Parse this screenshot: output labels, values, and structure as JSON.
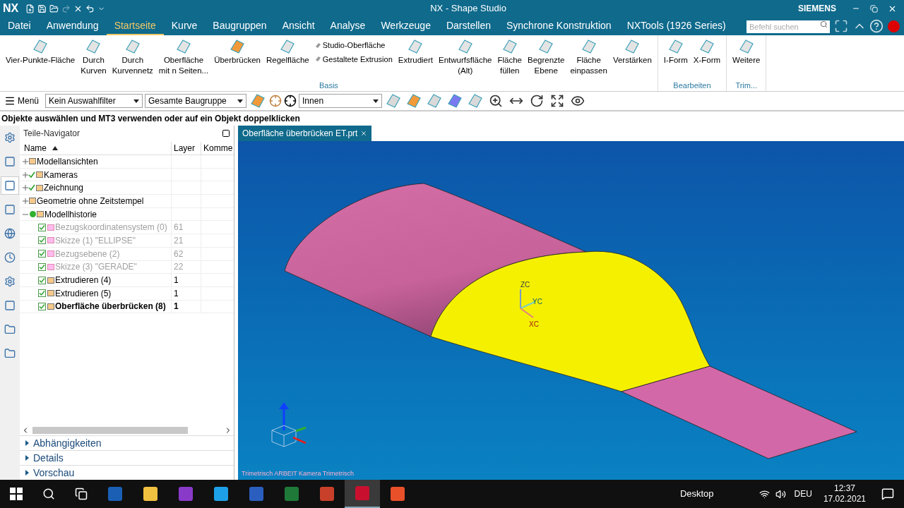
{
  "window": {
    "logo": "NX",
    "title": "NX - Shape Studio",
    "brand": "SIEMENS"
  },
  "menu_tabs": [
    {
      "label": "Datei",
      "selected": false
    },
    {
      "label": "Anwendung",
      "selected": false
    },
    {
      "label": "Startseite",
      "selected": true
    },
    {
      "label": "Kurve",
      "selected": false
    },
    {
      "label": "Baugruppen",
      "selected": false
    },
    {
      "label": "Ansicht",
      "selected": false
    },
    {
      "label": "Analyse",
      "selected": false
    },
    {
      "label": "Werkzeuge",
      "selected": false
    },
    {
      "label": "Darstellen",
      "selected": false
    },
    {
      "label": "Synchrone Konstruktion",
      "selected": false
    },
    {
      "label": "NXTools (1926 Series)",
      "selected": false
    }
  ],
  "search": {
    "placeholder": "Befehl suchen"
  },
  "ribbon_groups": [
    {
      "title": "Basis",
      "items": [
        {
          "kind": "big",
          "lines": [
            "Vier-Punkte-Fläche"
          ]
        },
        {
          "kind": "big",
          "lines": [
            "Durch",
            "Kurven"
          ]
        },
        {
          "kind": "big",
          "lines": [
            "Durch",
            "Kurvennetz"
          ]
        },
        {
          "kind": "big",
          "lines": [
            "Oberfläche",
            "mit n Seiten..."
          ]
        },
        {
          "kind": "big",
          "lines": [
            "Überbrücken"
          ]
        },
        {
          "kind": "big",
          "lines": [
            "Regelfläche"
          ]
        },
        {
          "kind": "small",
          "lines": [
            "Studio-Oberfläche",
            "Gestaltete Extrusion"
          ]
        },
        {
          "kind": "big",
          "lines": [
            "Extrudiert"
          ]
        },
        {
          "kind": "big",
          "lines": [
            "Entwurfsfläche",
            "(Alt)"
          ]
        },
        {
          "kind": "big",
          "lines": [
            "Fläche",
            "füllen"
          ]
        },
        {
          "kind": "big",
          "lines": [
            "Begrenzte",
            "Ebene"
          ]
        },
        {
          "kind": "big",
          "lines": [
            "Fläche",
            "einpassen"
          ]
        },
        {
          "kind": "big",
          "lines": [
            "Verstärken"
          ]
        }
      ]
    },
    {
      "title": "Bearbeiten",
      "items": [
        {
          "kind": "big",
          "lines": [
            "I-Form"
          ]
        },
        {
          "kind": "big",
          "lines": [
            "X-Form"
          ]
        }
      ]
    },
    {
      "title": "Trim...",
      "items": [
        {
          "kind": "big",
          "lines": [
            "Weitere"
          ]
        }
      ]
    }
  ],
  "toolbar": {
    "menu": "Menü",
    "filter": "Kein Auswahlfilter",
    "scope": "Gesamte Baugruppe",
    "mode": "Innen"
  },
  "cue_line": "Objekte auswählen und MT3 verwenden oder auf ein Objekt doppelklicken",
  "resource_bar": [
    {
      "selected": false
    },
    {
      "selected": false
    },
    {
      "selected": true
    },
    {
      "selected": false
    },
    {
      "selected": false
    },
    {
      "selected": false
    },
    {
      "selected": false
    },
    {
      "selected": false
    },
    {
      "selected": false
    },
    {
      "selected": false
    }
  ],
  "navigator": {
    "title": "Teile-Navigator",
    "columns": [
      "Name",
      "Layer",
      "Komme"
    ],
    "tree": [
      {
        "label": "Modellansichten",
        "expanded": false,
        "checked": false,
        "inactive": false,
        "current": false
      },
      {
        "label": "Kameras",
        "expanded": false,
        "checked": true,
        "inactive": false,
        "current": false
      },
      {
        "label": "Zeichnung",
        "expanded": false,
        "checked": true,
        "inactive": false,
        "current": false
      },
      {
        "label": "Geometrie ohne Zeitstempel",
        "expanded": false,
        "checked": false,
        "inactive": false,
        "current": false
      },
      {
        "label": "Modellhistorie",
        "expanded": true,
        "checked": false,
        "inactive": false,
        "current": false,
        "children": [
          {
            "label": "Bezugskoordinatensystem (0)",
            "layer": "61",
            "checked": true,
            "inactive": true,
            "current": false
          },
          {
            "label": "Skizze (1) \"ELLIPSE\"",
            "layer": "21",
            "checked": true,
            "inactive": true,
            "current": false
          },
          {
            "label": "Bezugsebene (2)",
            "layer": "62",
            "checked": true,
            "inactive": true,
            "current": false
          },
          {
            "label": "Skizze (3) \"GERADE\"",
            "layer": "22",
            "checked": true,
            "inactive": true,
            "current": false
          },
          {
            "label": "Extrudieren (4)",
            "layer": "1",
            "checked": true,
            "inactive": false,
            "current": false
          },
          {
            "label": "Extrudieren (5)",
            "layer": "1",
            "checked": true,
            "inactive": false,
            "current": false
          },
          {
            "label": "Oberfläche überbrücken (8)",
            "layer": "1",
            "checked": true,
            "inactive": false,
            "current": true
          }
        ]
      }
    ],
    "panels": [
      {
        "label": "Abhängigkeiten",
        "expanded": false
      },
      {
        "label": "Details",
        "expanded": false
      },
      {
        "label": "Vorschau",
        "expanded": false
      }
    ]
  },
  "document_tab": {
    "label": "Oberfläche überbrücken ET.prt"
  },
  "viewport": {
    "axes": [
      "ZC",
      "YC",
      "XC"
    ],
    "view_label": "Trimetrisch ARBEIT Kamera Trimetrisch"
  },
  "taskbar": {
    "desktop": "Desktop",
    "language": "DEU",
    "time": "12:37",
    "date": "17.02.2021"
  }
}
